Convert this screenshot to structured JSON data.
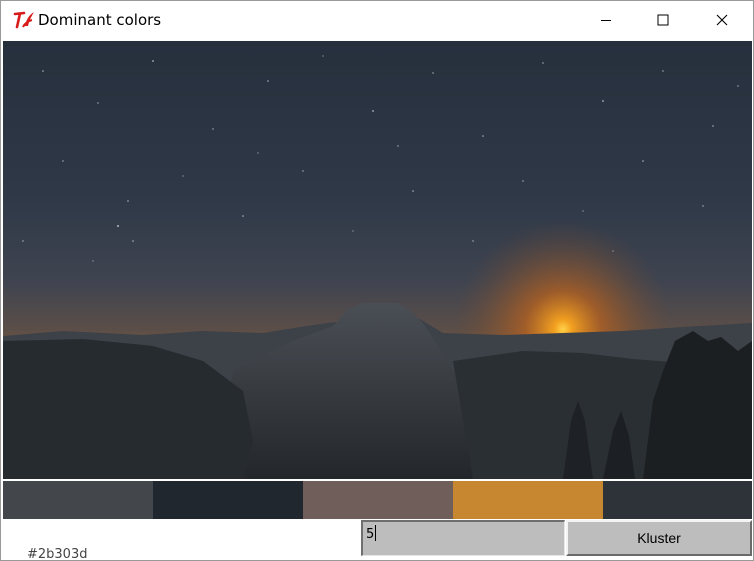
{
  "window": {
    "title": "Dominant colors",
    "app_icon": "tk-feather-icon"
  },
  "controls": {
    "minimize_icon": "minimize-icon",
    "maximize_icon": "maximize-icon",
    "close_icon": "close-icon"
  },
  "palette": {
    "colors": [
      "#43464b",
      "#21272e",
      "#6f5e59",
      "#c78730",
      "#2d3339"
    ]
  },
  "bottom": {
    "hex_label": "#2b303d",
    "cluster_count": "5",
    "button_label": "Kluster"
  }
}
